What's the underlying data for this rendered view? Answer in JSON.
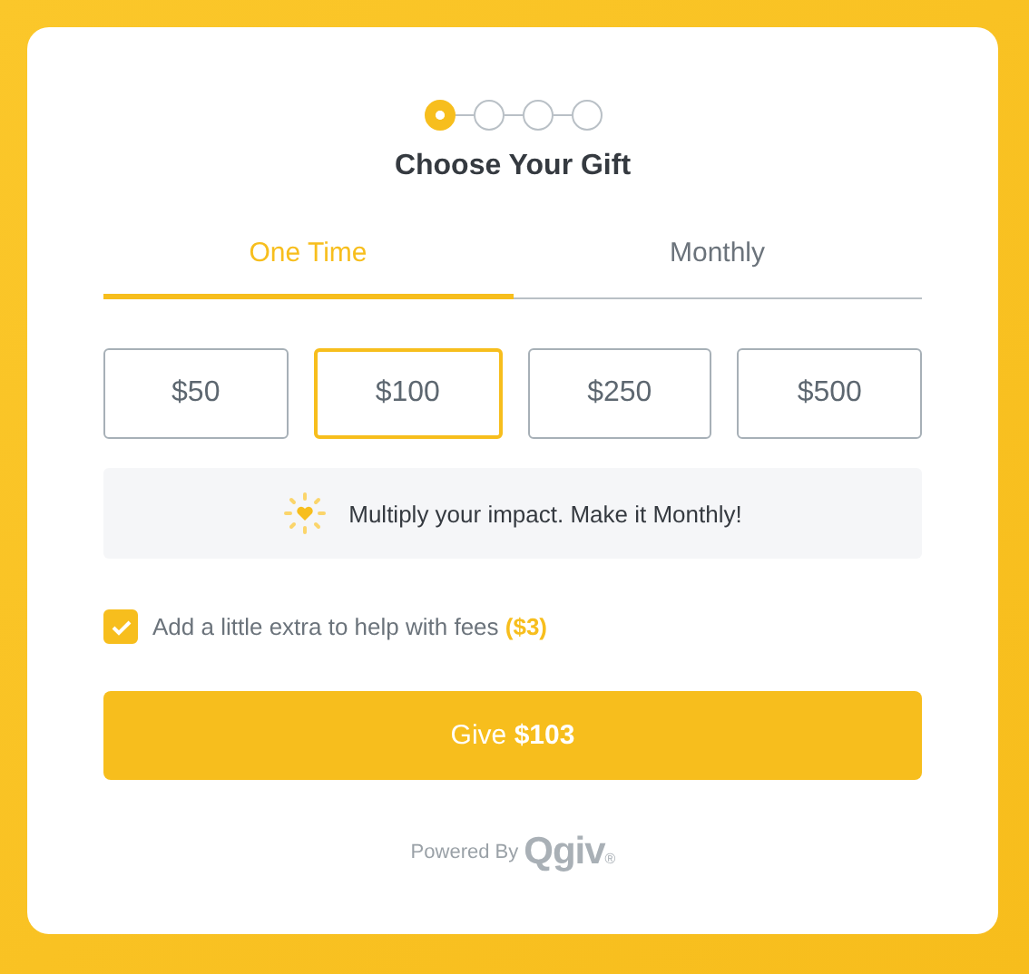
{
  "steps": [
    {
      "selected": true
    },
    {
      "selected": false
    },
    {
      "selected": false
    },
    {
      "selected": false
    }
  ],
  "title": "Choose Your Gift",
  "tabs": [
    {
      "label": "One Time",
      "selected": true
    },
    {
      "label": "Monthly",
      "selected": false
    }
  ],
  "amounts": [
    {
      "label": "$50",
      "selected": false
    },
    {
      "label": "$100",
      "selected": true
    },
    {
      "label": "$250",
      "selected": false
    },
    {
      "label": "$500",
      "selected": false
    }
  ],
  "promo": "Multiply your impact. Make it Monthly!",
  "fee": {
    "label": "Add a little extra to help with fees **($3)**",
    "checked": true
  },
  "give_button": "Give **$103**",
  "footer": {
    "powered_by": "Powered By",
    "logo": "Qgiv",
    "mark": "®"
  }
}
